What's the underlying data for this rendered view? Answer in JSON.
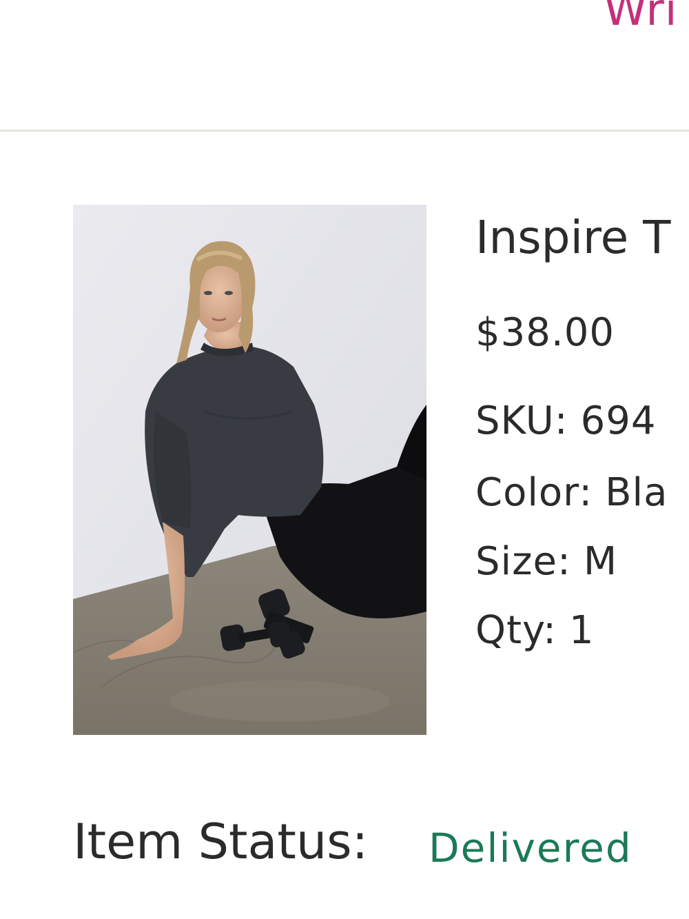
{
  "header": {
    "link_text": "Wri"
  },
  "product": {
    "name": "Inspire T",
    "price": "$38.00",
    "image_alt": "Model seated on concrete floor wearing oversized black tee and black leggings beside small dumbbells",
    "attributes": {
      "sku": {
        "label": "SKU:",
        "value": "694"
      },
      "color": {
        "label": "Color:",
        "value": "Bla"
      },
      "size": {
        "label": "Size:",
        "value": "M"
      },
      "qty": {
        "label": "Qty:",
        "value": "1"
      }
    }
  },
  "status": {
    "label": "Item Status:",
    "value": "Delivered"
  },
  "colors": {
    "link": "#c4307a",
    "status_delivered": "#1b7a55",
    "divider": "#e6e3df",
    "text": "#2b2b2b"
  }
}
